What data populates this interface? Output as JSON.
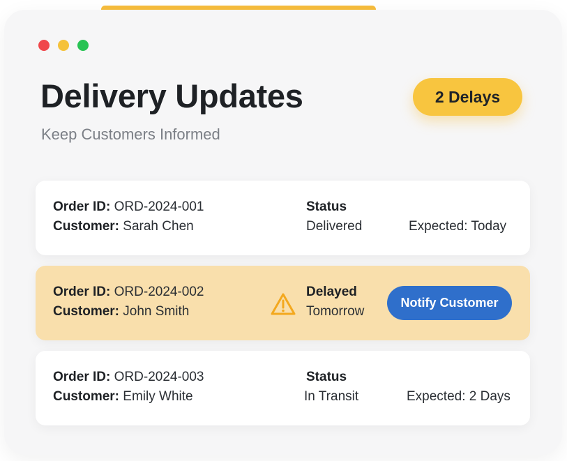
{
  "header": {
    "title": "Delivery Updates",
    "subtitle": "Keep Customers Informed",
    "delays_badge": "2 Delays"
  },
  "labels": {
    "order_id": "Order ID:",
    "customer": "Customer:"
  },
  "orders": [
    {
      "order_id": "ORD-2024-001",
      "customer": "Sarah Chen",
      "status_label": "Status",
      "status_value": "Delivered",
      "expected": "Expected: Today"
    },
    {
      "order_id": "ORD-2024-002",
      "customer": "John Smith",
      "status_label": "Delayed",
      "status_value": "Tomorrow",
      "action_label": "Notify Customer",
      "icon": "warning-icon"
    },
    {
      "order_id": "ORD-2024-003",
      "customer": "Emily White",
      "status_label": "Status",
      "status_value": "In Transit",
      "expected": "Expected: 2 Days"
    }
  ],
  "colors": {
    "accent_yellow": "#f8c53f",
    "delayed_card": "#f9dfac",
    "notify_button": "#2f6fcb",
    "traffic_red": "#f0474b",
    "traffic_yellow": "#f5c23b",
    "traffic_green": "#28c354"
  }
}
